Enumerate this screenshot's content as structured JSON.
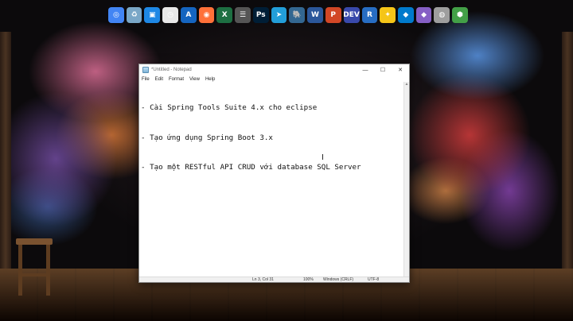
{
  "taskbar": {
    "icons": [
      {
        "name": "chrome-icon",
        "glyph": "◎",
        "color": "#4285f4"
      },
      {
        "name": "recycle-bin-icon",
        "glyph": "♻",
        "color": "#7aa7c7"
      },
      {
        "name": "screenshot-tool-icon",
        "glyph": "▣",
        "color": "#1e88e5"
      },
      {
        "name": "clock-icon",
        "glyph": "◷",
        "color": "#e8e8e8"
      },
      {
        "name": "font-tool-icon",
        "glyph": "A",
        "color": "#1565c0"
      },
      {
        "name": "firefox-icon",
        "glyph": "◉",
        "color": "#ff7139"
      },
      {
        "name": "excel-icon",
        "glyph": "X",
        "color": "#1d6f42"
      },
      {
        "name": "settings-icon",
        "glyph": "☰",
        "color": "#555555"
      },
      {
        "name": "photoshop-icon",
        "glyph": "Ps",
        "color": "#001e36"
      },
      {
        "name": "telegram-icon",
        "glyph": "➤",
        "color": "#229ed9"
      },
      {
        "name": "postgres-icon",
        "glyph": "🐘",
        "color": "#336791"
      },
      {
        "name": "word-icon",
        "glyph": "W",
        "color": "#2b579a"
      },
      {
        "name": "powerpoint-icon",
        "glyph": "P",
        "color": "#d24726"
      },
      {
        "name": "devtools-icon",
        "glyph": "DEV",
        "color": "#3949ab"
      },
      {
        "name": "r-icon",
        "glyph": "R",
        "color": "#276dc3"
      },
      {
        "name": "yellow-app-icon",
        "glyph": "✦",
        "color": "#f5c518"
      },
      {
        "name": "vscode-icon",
        "glyph": "◆",
        "color": "#007acc"
      },
      {
        "name": "visual-studio-icon",
        "glyph": "◆",
        "color": "#865fc5"
      },
      {
        "name": "database-icon",
        "glyph": "◍",
        "color": "#9e9e9e"
      },
      {
        "name": "green-hex-icon",
        "glyph": "⬢",
        "color": "#43a047"
      }
    ]
  },
  "notepad": {
    "title": "*Untitled - Notepad",
    "menu": [
      "File",
      "Edit",
      "Format",
      "View",
      "Help"
    ],
    "lines": [
      "- Cài Spring Tools Suite 4.x cho eclipse",
      "- Tạo ứng dụng Spring Boot 3.x",
      "- Tạo một RESTful API CRUD với database SQL Server"
    ],
    "status": {
      "position": "Ln 3, Col 31",
      "zoom": "100%",
      "line_ending": "Windows (CRLF)",
      "encoding": "UTF-8"
    },
    "buttons": {
      "minimize": "—",
      "maximize": "☐",
      "close": "✕"
    }
  },
  "cursor_glyph": "I"
}
